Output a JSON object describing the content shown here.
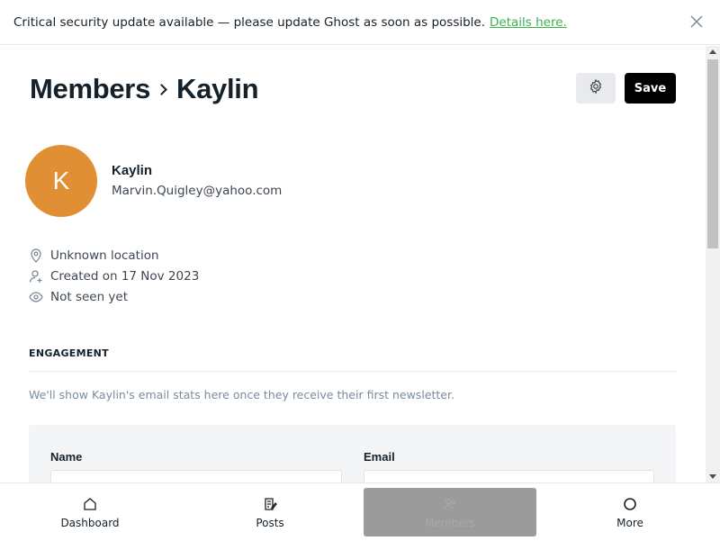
{
  "banner": {
    "message": "Critical security update available — please update Ghost as soon as possible.",
    "link_text": "Details here."
  },
  "header": {
    "breadcrumb_parent": "Members",
    "breadcrumb_current": "Kaylin",
    "save_label": "Save"
  },
  "member": {
    "initial": "K",
    "name": "Kaylin",
    "email": "Marvin.Quigley@yahoo.com",
    "avatar_color": "#e18f35",
    "location": "Unknown location",
    "created": "Created on 17 Nov 2023",
    "last_seen": "Not seen yet"
  },
  "engagement": {
    "label": "ENGAGEMENT",
    "note": "We'll show Kaylin's email stats here once they receive their first newsletter."
  },
  "form": {
    "name_label": "Name",
    "email_label": "Email"
  },
  "nav": {
    "items": [
      {
        "label": "Dashboard",
        "icon": "home-icon"
      },
      {
        "label": "Posts",
        "icon": "posts-icon"
      },
      {
        "label": "Members",
        "icon": "members-icon"
      },
      {
        "label": "More",
        "icon": "circle-icon"
      }
    ]
  }
}
